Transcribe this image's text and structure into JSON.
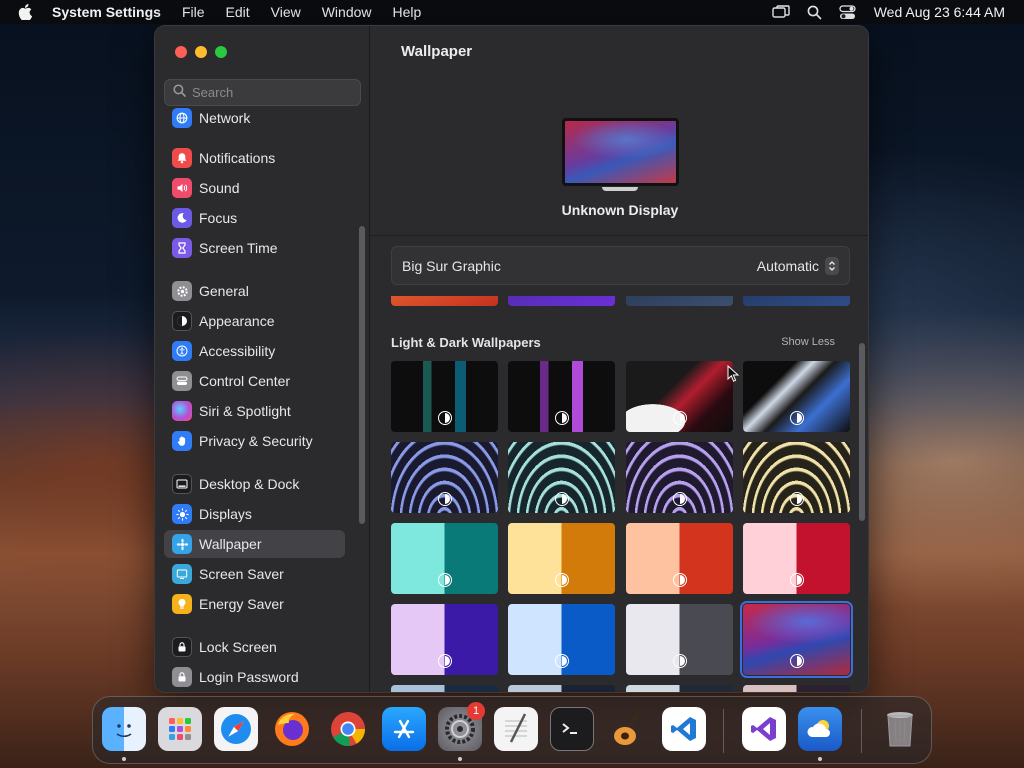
{
  "menubar": {
    "app_name": "System Settings",
    "menus": [
      "File",
      "Edit",
      "View",
      "Window",
      "Help"
    ],
    "clock": "Wed Aug 23  6:44 AM"
  },
  "sidebar": {
    "search_placeholder": "Search",
    "items": [
      {
        "label": "Network",
        "icon": "globe-icon",
        "color": "#2f7cf6"
      },
      {
        "label": "Notifications",
        "icon": "bell-icon",
        "color": "#ef4b4b"
      },
      {
        "label": "Sound",
        "icon": "speaker-icon",
        "color": "#ef4b6b"
      },
      {
        "label": "Focus",
        "icon": "moon-icon",
        "color": "#6b5ae6"
      },
      {
        "label": "Screen Time",
        "icon": "hourglass-icon",
        "color": "#7a5ae6"
      },
      {
        "label": "General",
        "icon": "gear-icon",
        "color": "#8e8e93"
      },
      {
        "label": "Appearance",
        "icon": "appearance-icon",
        "color": "#1c1c1e"
      },
      {
        "label": "Accessibility",
        "icon": "accessibility-icon",
        "color": "#2f7cf6"
      },
      {
        "label": "Control Center",
        "icon": "control-center-icon",
        "color": "#8e8e93"
      },
      {
        "label": "Siri & Spotlight",
        "icon": "siri-icon",
        "color": "#b34fd6"
      },
      {
        "label": "Privacy & Security",
        "icon": "hand-icon",
        "color": "#2f7cf6"
      },
      {
        "label": "Desktop & Dock",
        "icon": "dock-icon",
        "color": "#1c1c1e"
      },
      {
        "label": "Displays",
        "icon": "sun-icon",
        "color": "#2f7cf6"
      },
      {
        "label": "Wallpaper",
        "icon": "wallpaper-icon",
        "color": "#35a3e8",
        "selected": true
      },
      {
        "label": "Screen Saver",
        "icon": "screen-saver-icon",
        "color": "#3aa8d8"
      },
      {
        "label": "Energy Saver",
        "icon": "bulb-icon",
        "color": "#f5b21b"
      },
      {
        "label": "Lock Screen",
        "icon": "lock-icon",
        "color": "#1c1c1e"
      },
      {
        "label": "Login Password",
        "icon": "lock-password-icon",
        "color": "#8e8e93"
      }
    ]
  },
  "main": {
    "title": "Wallpaper",
    "display_name": "Unknown Display",
    "current_wallpaper": "Big Sur Graphic",
    "mode": "Automatic",
    "section_title": "Light & Dark Wallpapers",
    "show_less_label": "Show Less"
  },
  "dock": {
    "badge_count": "1",
    "apps": [
      {
        "name": "finder-icon",
        "color": "#2f8cf6"
      },
      {
        "name": "launchpad-icon",
        "color": "#d8d8dc"
      },
      {
        "name": "safari-icon",
        "color": "#2b8ef2"
      },
      {
        "name": "firefox-icon",
        "color": "#ff7a1a"
      },
      {
        "name": "chrome-icon",
        "color": "#e9e9e9"
      },
      {
        "name": "app-store-icon",
        "color": "#1a8cf6"
      },
      {
        "name": "system-settings-icon",
        "color": "#8a8a8e"
      },
      {
        "name": "textedit-icon",
        "color": "#f1f1f1"
      },
      {
        "name": "terminal-icon",
        "color": "#1c1c1e"
      },
      {
        "name": "garageband-icon",
        "color": "#e0a050"
      },
      {
        "name": "vscode-icon",
        "color": "#ffffff"
      },
      {
        "name": "visual-studio-icon",
        "color": "#ffffff"
      },
      {
        "name": "weather-icon",
        "color": "#2a7fe0"
      },
      {
        "name": "trash-icon",
        "color": "#9a9aa0"
      }
    ]
  }
}
